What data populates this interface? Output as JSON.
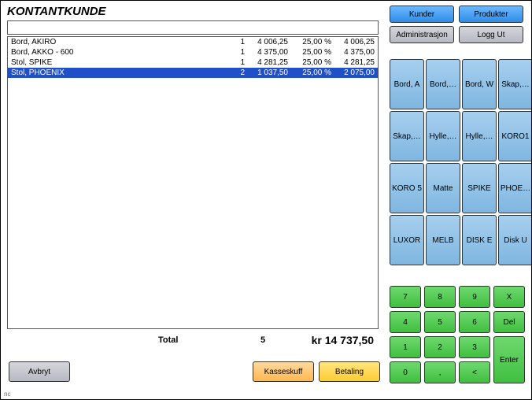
{
  "title": "KONTANTKUNDE",
  "search_value": "",
  "lines": [
    {
      "name": "Bord, AKIRO",
      "qty": "1",
      "price": "4 006,25",
      "vat": "25,00 %",
      "sum": "4 006,25",
      "sel": false
    },
    {
      "name": "Bord, AKKO - 600",
      "qty": "1",
      "price": "4 375,00",
      "vat": "25,00 %",
      "sum": "4 375,00",
      "sel": false
    },
    {
      "name": "Stol, SPIKE",
      "qty": "1",
      "price": "4 281,25",
      "vat": "25,00 %",
      "sum": "4 281,25",
      "sel": false
    },
    {
      "name": "Stol, PHOENIX",
      "qty": "2",
      "price": "1 037,50",
      "vat": "25,00 %",
      "sum": "2 075,00",
      "sel": true
    }
  ],
  "totals": {
    "label": "Total",
    "qty": "5",
    "amount": "kr 14 737,50"
  },
  "bottom": {
    "cancel": "Avbryt",
    "kasseskuff": "Kasseskuff",
    "betaling": "Betaling"
  },
  "top": {
    "kunder": "Kunder",
    "produkter": "Produkter",
    "admin": "Administrasjon",
    "logout": "Logg Ut"
  },
  "products": [
    "Bord, A",
    "Bord,…",
    "Bord, W",
    "Skap,…",
    "Skap,…",
    "Hylle,…",
    "Hylle,…",
    "KORO1",
    "KORO 5",
    "Matte",
    "SPIKE",
    "PHOE…",
    "LUXOR",
    "MELB",
    "DISK E",
    "Disk U"
  ],
  "keypad": {
    "r1": [
      "7",
      "8",
      "9"
    ],
    "r1x": "X",
    "r2": [
      "4",
      "5",
      "6"
    ],
    "r2x": "Del",
    "r3": [
      "1",
      "2",
      "3"
    ],
    "r4": [
      "0",
      ",",
      "<"
    ],
    "enter": "Enter"
  },
  "status": "nc"
}
